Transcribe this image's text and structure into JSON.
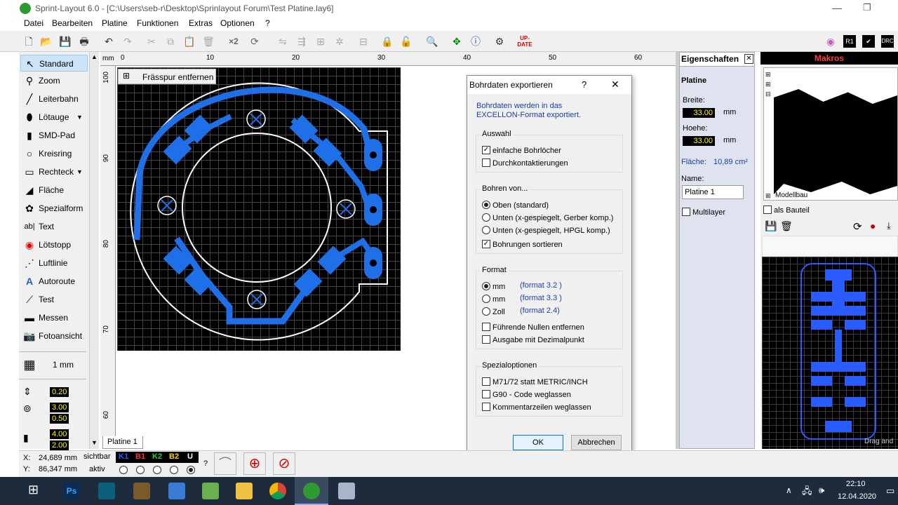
{
  "window": {
    "title": "Sprint-Layout 6.0 - [C:\\Users\\seb-r\\Desktop\\Sprinlayout Forum\\Test Platine.lay6]"
  },
  "menu": [
    "Datei",
    "Bearbeiten",
    "Platine",
    "Funktionen",
    "Extras",
    "Optionen",
    "?"
  ],
  "toolbar": {
    "x2_label": "×2",
    "update_label": "UP-DATE"
  },
  "tools": [
    {
      "label": "Standard",
      "icon": "pointer-icon"
    },
    {
      "label": "Zoom",
      "icon": "magnifier-icon"
    },
    {
      "label": "Leiterbahn",
      "icon": "track-icon"
    },
    {
      "label": "Lötauge",
      "icon": "pad-icon"
    },
    {
      "label": "SMD-Pad",
      "icon": "smd-pad-icon"
    },
    {
      "label": "Kreisring",
      "icon": "ring-icon"
    },
    {
      "label": "Rechteck",
      "icon": "rectangle-icon"
    },
    {
      "label": "Fläche",
      "icon": "zone-icon"
    },
    {
      "label": "Spezialform",
      "icon": "special-shape-icon"
    },
    {
      "label": "Text",
      "icon": "text-icon"
    },
    {
      "label": "Lötstopp",
      "icon": "solder-stop-icon"
    },
    {
      "label": "Luftlinie",
      "icon": "airwire-icon"
    },
    {
      "label": "Autoroute",
      "icon": "autoroute-icon"
    },
    {
      "label": "Test",
      "icon": "test-icon"
    },
    {
      "label": "Messen",
      "icon": "measure-icon"
    },
    {
      "label": "Fotoansicht",
      "icon": "camera-icon"
    }
  ],
  "grid": {
    "label": "1 mm"
  },
  "params": {
    "v1": "0.20",
    "v2": "3.00",
    "v3": "0.50",
    "v4": "4.00",
    "v5": "2.00"
  },
  "ruler": {
    "unit": "mm",
    "top": [
      "0",
      "10",
      "20",
      "30",
      "40",
      "50",
      "60"
    ],
    "left": [
      "100",
      "90",
      "80",
      "70",
      "60"
    ]
  },
  "canvas": {
    "fraesspur": "Frässpur entfernen",
    "tab": "Platine 1"
  },
  "dialog": {
    "title": "Bohrdaten exportieren",
    "help": "?",
    "close": "✕",
    "intro1": "Bohrdaten werden in das",
    "intro2": "EXCELLON-Format exportiert.",
    "auswahl": {
      "title": "Auswahl",
      "o1": "einfache Bohrlöcher",
      "o2": "Durchkontaktierungen"
    },
    "bohren": {
      "title": "Bohren von...",
      "o1": "Oben (standard)",
      "o2": "Unten (x-gespiegelt, Gerber komp.)",
      "o3": "Unten (x-gespiegelt, HPGL komp.)",
      "o4": "Bohrungen sortieren"
    },
    "format": {
      "title": "Format",
      "u1": "mm",
      "f1": "(format 3.2 )",
      "u2": "mm",
      "f2": "(format 3.3 )",
      "u3": "Zoll",
      "f3": "(format 2.4)",
      "o1": "Führende Nullen entfernen",
      "o2": "Ausgabe mit Dezimalpunkt"
    },
    "spezial": {
      "title": "Spezialoptionen",
      "o1": "M71/72 statt METRIC/INCH",
      "o2": "G90 - Code weglassen",
      "o3": "Kommentarzeilen weglassen"
    },
    "ok": "OK",
    "cancel": "Abbrechen"
  },
  "props": {
    "title": "Eigenschaften",
    "section": "Platine",
    "breite_label": "Breite:",
    "breite": "33.00",
    "hoehe_label": "Hoehe:",
    "hoehe": "33.00",
    "unit": "mm",
    "flaeche_label": "Fläche:",
    "flaeche": "10,89 cm²",
    "name_label": "Name:",
    "name": "Platine 1",
    "multilayer": "Multilayer"
  },
  "macros": {
    "title": "Makros",
    "modellbau": "Modellbau",
    "als_bauteil": "als Bauteil",
    "drag": "Drag and"
  },
  "status": {
    "x_label": "X:",
    "x": "24,689 mm",
    "y_label": "Y:",
    "y": "86,347 mm",
    "sichtbar": "sichtbar",
    "aktiv": "aktiv",
    "layers": [
      "K1",
      "B1",
      "K2",
      "B2",
      "U"
    ],
    "q": "?"
  },
  "taskbar": {
    "time": "22:10",
    "date": "12.04.2020",
    "ps": "Ps"
  },
  "colors": {
    "track": "#1f6fe8",
    "k1": "#2a5cff",
    "b1": "#ff3030",
    "k2": "#2ecc40",
    "b2": "#ffd000",
    "u": "#ffffff"
  }
}
